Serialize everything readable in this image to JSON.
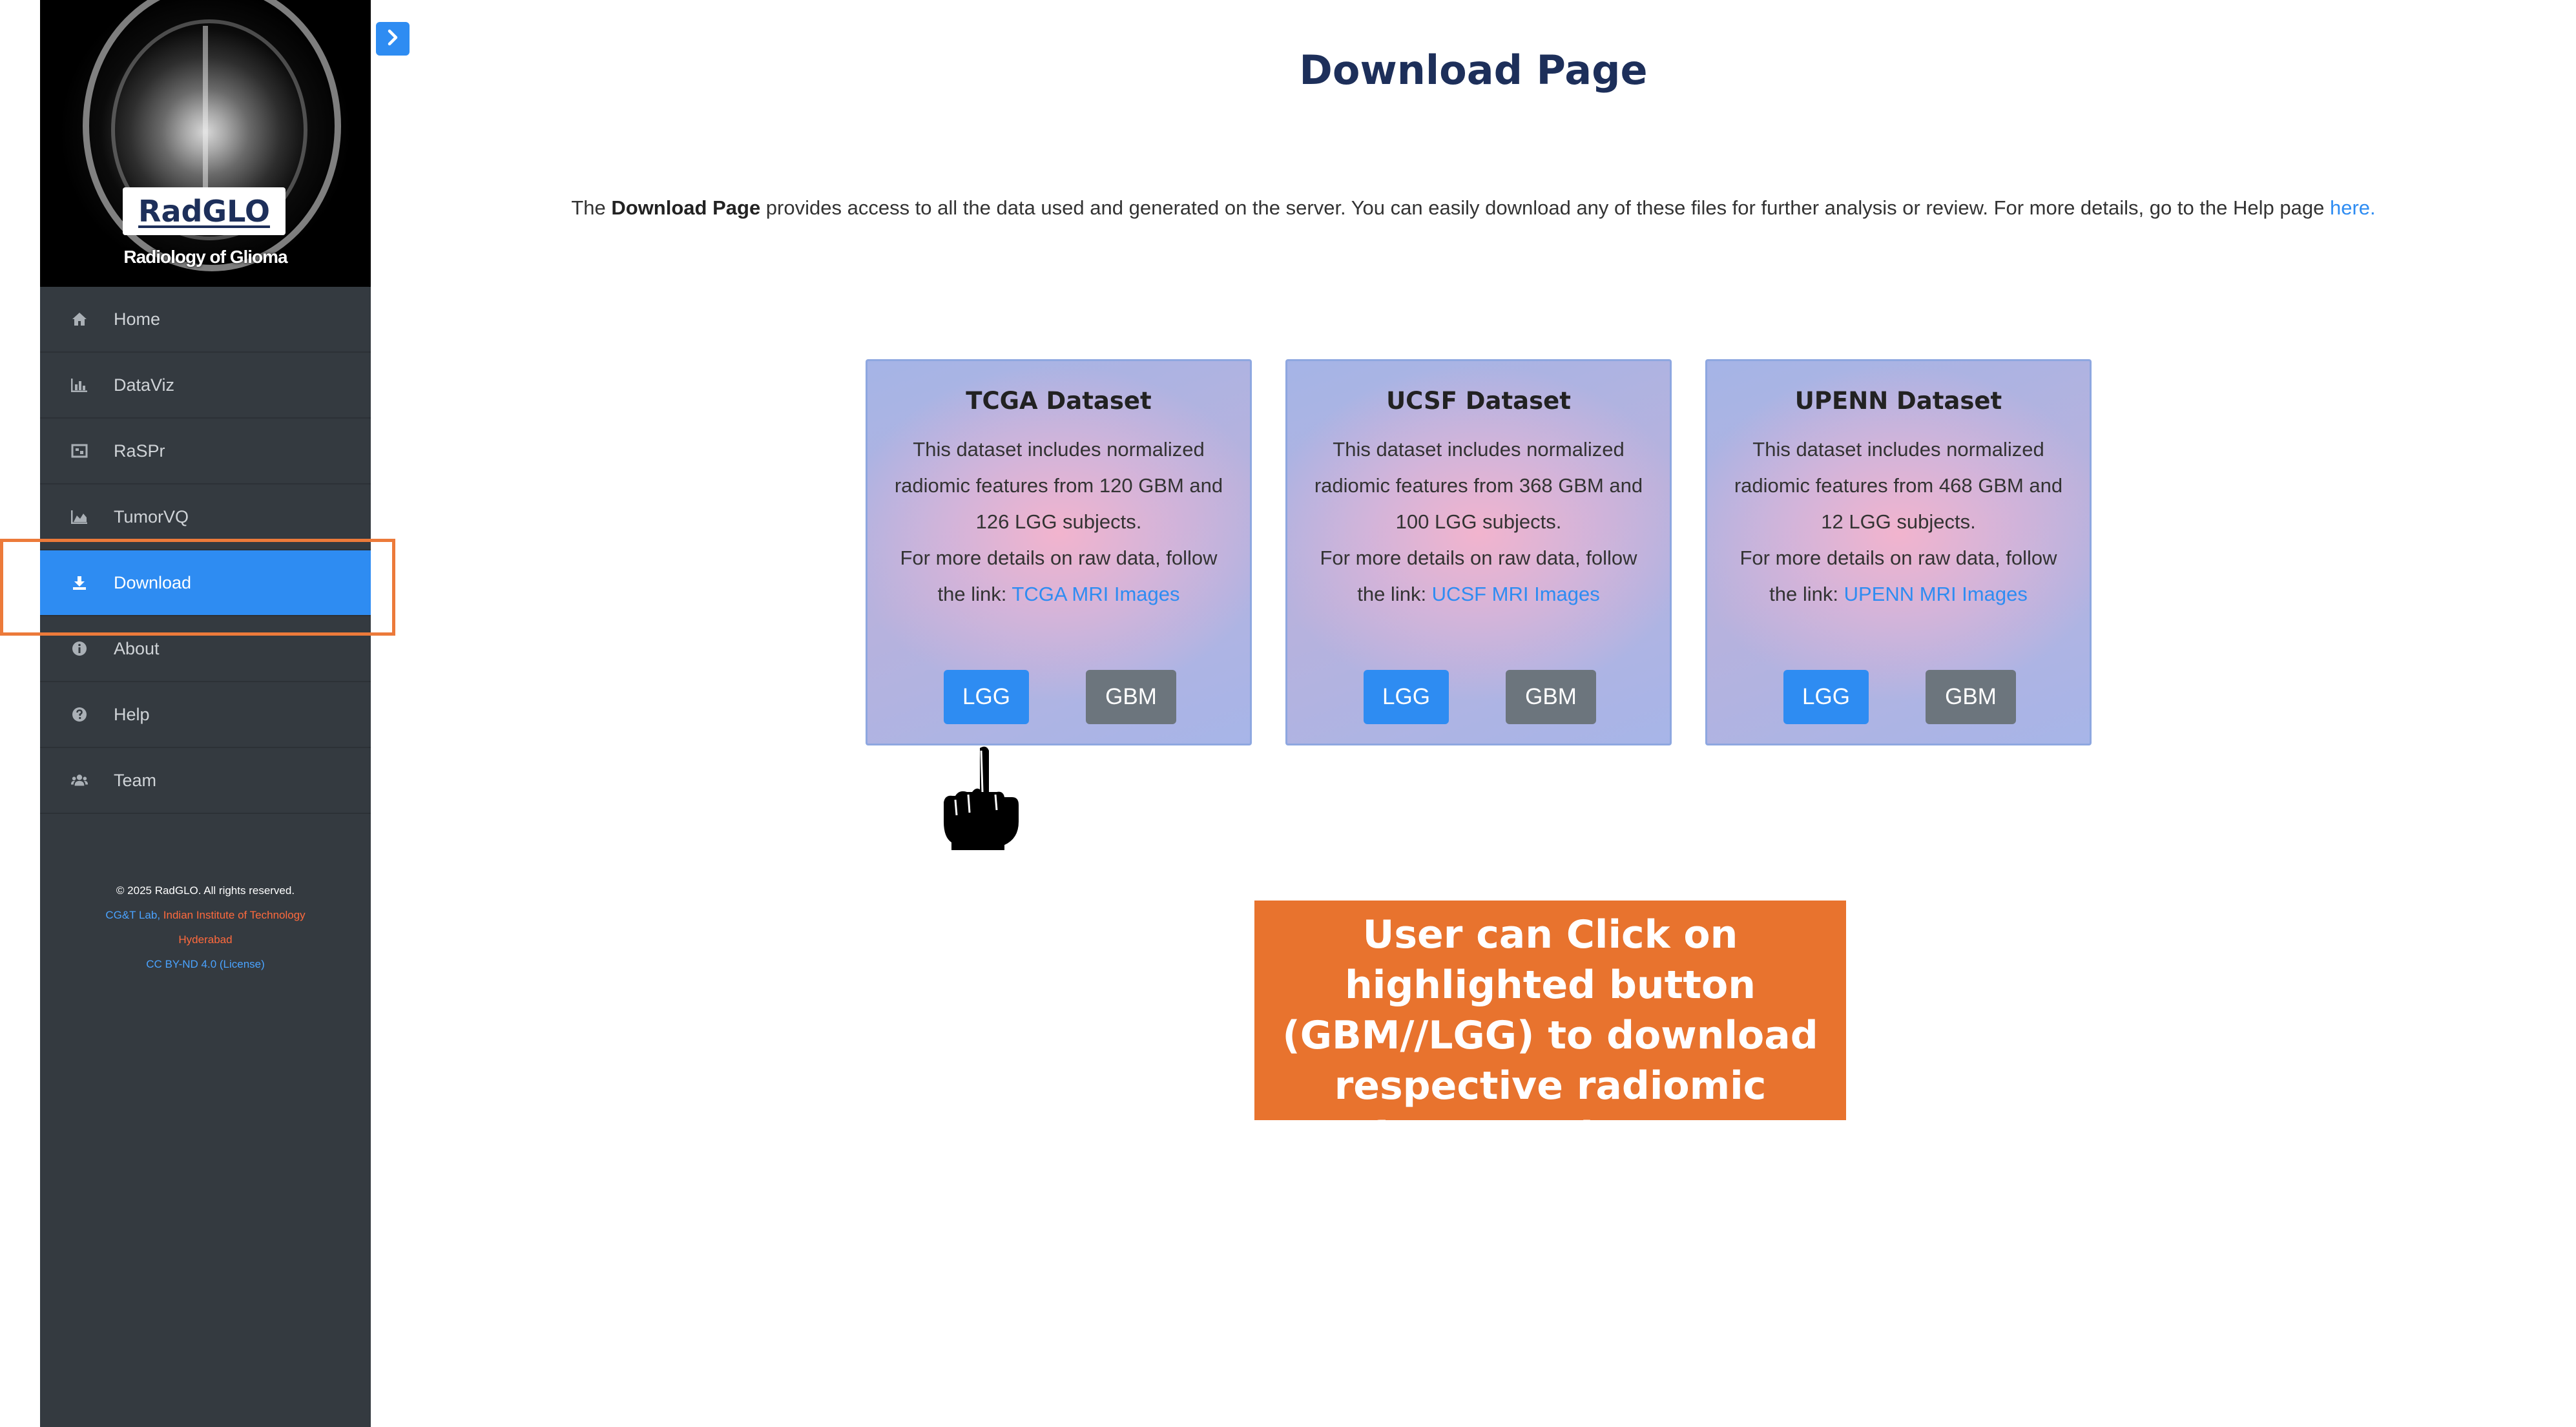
{
  "sidebar": {
    "brand": {
      "logo": "RadGLO",
      "tagline": "Radiology of Glioma"
    },
    "items": [
      {
        "label": "Home",
        "icon": "home-icon"
      },
      {
        "label": "DataViz",
        "icon": "bar-chart-icon"
      },
      {
        "label": "RaSPr",
        "icon": "image-icon"
      },
      {
        "label": "TumorVQ",
        "icon": "area-chart-icon"
      },
      {
        "label": "Download",
        "icon": "download-icon",
        "active": true
      },
      {
        "label": "About",
        "icon": "info-icon"
      },
      {
        "label": "Help",
        "icon": "question-icon"
      },
      {
        "label": "Team",
        "icon": "users-icon"
      }
    ],
    "footer": {
      "copyright": "© 2025 RadGLO. All rights reserved.",
      "lab": "CG&T Lab,",
      "institute_1": "Indian Institute of Technology",
      "institute_2": "Hyderabad",
      "license": "CC BY-ND 4.0 (License)"
    }
  },
  "page": {
    "title": "Download Page",
    "intro": {
      "prefix": "The ",
      "bold": "Download Page",
      "text": " provides access to all the data used and generated on the server. You can easily download any of these files for further analysis or review. For more details, go to the Help page ",
      "link": "here."
    }
  },
  "cards": [
    {
      "title": "TCGA Dataset",
      "desc": "This dataset includes normalized radiomic features from 120 GBM and 126 LGG subjects.",
      "more": "For more details on raw data, follow the link: ",
      "link": "TCGA MRI Images",
      "lgg": "LGG",
      "gbm": "GBM"
    },
    {
      "title": "UCSF Dataset",
      "desc": "This dataset includes normalized radiomic features from 368 GBM and 100 LGG subjects.",
      "more": "For more details on raw data, follow the link: ",
      "link": "UCSF MRI Images",
      "lgg": "LGG",
      "gbm": "GBM"
    },
    {
      "title": "UPENN Dataset",
      "desc": "This dataset includes normalized radiomic features from 468 GBM and 12 LGG subjects.",
      "more": "For more details on raw data, follow the link: ",
      "link": "UPENN MRI Images",
      "lgg": "LGG",
      "gbm": "GBM"
    }
  ],
  "callout": "User can Click on highlighted button (GBM//LGG) to download respective radiomic features dataset",
  "colors": {
    "sidebar_bg": "#343a40",
    "accent": "#2e8cf2",
    "gbm_button": "#6c757d",
    "callout_bg": "#e8732e",
    "title": "#1d2f5a"
  }
}
